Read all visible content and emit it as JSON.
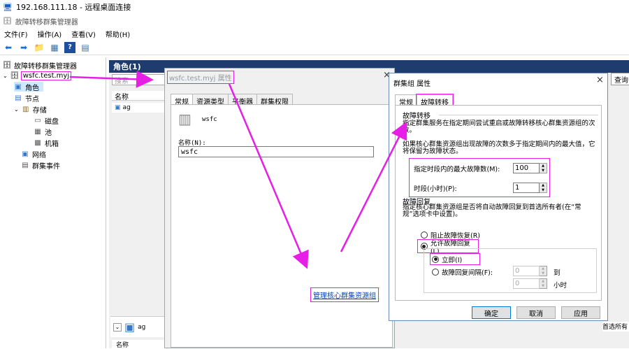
{
  "window_title": "192.168.111.18 - 远程桌面连接",
  "app_title": "故障转移群集管理器",
  "menu": [
    "文件(F)",
    "操作(A)",
    "查看(V)",
    "帮助(H)"
  ],
  "tree": {
    "root": "故障转移群集管理器",
    "cluster": "wsfc.test.myj",
    "roles": "角色",
    "nodes": "节点",
    "storage": "存储",
    "disks": "磁盘",
    "pools": "池",
    "enclosures": "机箱",
    "network": "网络",
    "cluster_events": "群集事件"
  },
  "roles_panel": {
    "header": "角色(1)",
    "search_placeholder": "搜索",
    "query_button": "查询",
    "col_name": "名称",
    "row_name": "ag",
    "bottom_role": "ag",
    "bottom_col_name": "名称",
    "preferred_owner": "首选所有"
  },
  "props_dialog": {
    "title": "wsfc.test.myj 属性",
    "tabs": [
      "常规",
      "资源类型",
      "平衡器",
      "群集权限"
    ],
    "server_label": "wsfc",
    "name_label": "名称(N):",
    "name_value": "wsfc",
    "link": "管理核心群集资源组"
  },
  "group_dialog": {
    "title": "群集组 属性",
    "tabs": [
      "常规",
      "故障转移"
    ],
    "failover_section": "故障转移",
    "failover_desc": "指定群集服务在指定期间尝试重启或故障转移核心群集资源组的次数。",
    "failover_desc2": "如果核心群集资源组出现故障的次数多于指定期间内的最大值，它将保留为故障状态。",
    "max_failures_label": "指定时段内的最大故障数(M):",
    "max_failures_value": "100",
    "period_label": "时段(小时)(P):",
    "period_value": "1",
    "failback_section": "故障回复",
    "failback_desc": "指定核心群集资源组是否将自动故障回复到首选所有者(在“常规”选项卡中设置)。",
    "prevent_failback": "阻止故障恢复(R)",
    "allow_failback": "允许故障回复(L)",
    "immediately": "立即(I)",
    "failback_between": "故障回复间隔(F):",
    "between_from": "0",
    "between_to": "0",
    "to_label": "到",
    "hours_label": "小时",
    "ok": "确定",
    "cancel": "取消",
    "apply": "应用"
  },
  "colors": {
    "annotation": "#e61ee6",
    "roles_header": "#1e3d6e",
    "link": "#0645ad"
  }
}
